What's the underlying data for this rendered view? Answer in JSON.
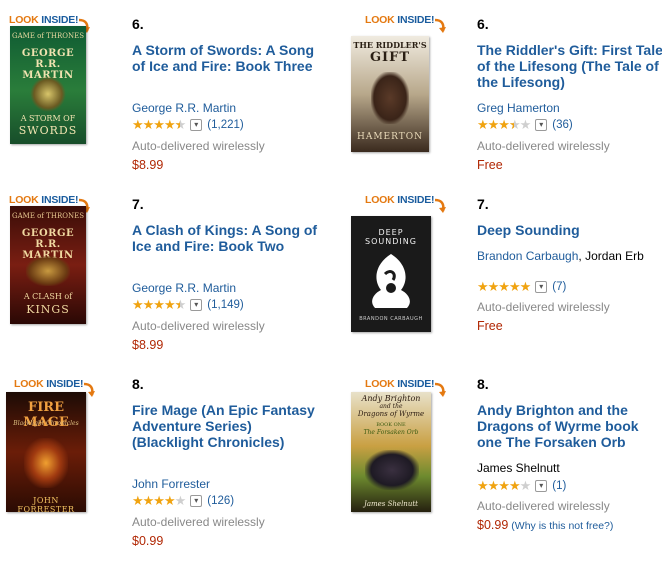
{
  "look_inside": {
    "look": "LOOK",
    "inside": "INSIDE!"
  },
  "items": [
    {
      "rank": "6.",
      "title": "A Storm of Swords: A Song of Ice and Fire: Book Three",
      "authors": [
        "George R.R. Martin"
      ],
      "rating": {
        "stars": 4.5,
        "count": "(1,221)"
      },
      "delivery": "Auto-delivered wirelessly",
      "price": "$8.99",
      "cover": {
        "series": "GAME of THRONES",
        "author": "GEORGE R.R. MARTIN",
        "title_line1": "A STORM OF",
        "title_line2": "SWORDS"
      }
    },
    {
      "rank": "6.",
      "title": "The Riddler's Gift: First Tale of the Lifesong (The Tale of the Lifesong)",
      "authors": [
        "Greg Hamerton"
      ],
      "rating": {
        "stars": 3.5,
        "count": "(36)"
      },
      "delivery": "Auto-delivered wirelessly",
      "price": "Free",
      "cover": {
        "title_line1": "THE RIDDLER'S",
        "title_line2": "GIFT",
        "author": "HAMERTON"
      }
    },
    {
      "rank": "7.",
      "title": "A Clash of Kings: A Song of Ice and Fire: Book Two",
      "authors": [
        "George R.R. Martin"
      ],
      "rating": {
        "stars": 4.5,
        "count": "(1,149)"
      },
      "delivery": "Auto-delivered wirelessly",
      "price": "$8.99",
      "cover": {
        "series": "GAME of THRONES",
        "author": "GEORGE R.R. MARTIN",
        "title_line1": "A CLASH of",
        "title_line2": "KINGS"
      }
    },
    {
      "rank": "7.",
      "title": "Deep Sounding",
      "authors": [
        "Brandon Carbaugh",
        "Jordan Erb"
      ],
      "rating": {
        "stars": 5,
        "count": "(7)"
      },
      "delivery": "Auto-delivered wirelessly",
      "price": "Free",
      "cover": {
        "title": "DEEP SOUNDING",
        "author": "BRANDON CARBAUGH"
      }
    },
    {
      "rank": "8.",
      "title": "Fire Mage (An Epic Fantasy Adventure Series) (Blacklight Chronicles)",
      "authors": [
        "John Forrester"
      ],
      "rating": {
        "stars": 4,
        "count": "(126)"
      },
      "delivery": "Auto-delivered wirelessly",
      "price": "$0.99",
      "cover": {
        "title": "FIRE MAGE",
        "subtitle": "Blacklight Chronicles",
        "author": "JOHN FORRESTER"
      }
    },
    {
      "rank": "8.",
      "title": "Andy Brighton and the Dragons of Wyrme book one The Forsaken Orb",
      "authors": [
        "James Shelnutt"
      ],
      "rating": {
        "stars": 4,
        "count": "(1)"
      },
      "delivery": "Auto-delivered wirelessly",
      "price": "$0.99",
      "price_note": "(Why is this not free?)",
      "cover": {
        "title_line1": "Andy Brighton",
        "title_line2": "and the",
        "title_line3": "Dragons of Wyrme",
        "sub": "BOOK ONE",
        "sub2": "The Forsaken Orb",
        "author": "James Shelnutt"
      }
    }
  ],
  "colors": {
    "link": "#1f5c9b",
    "price": "#b12704",
    "star": "#f0a310",
    "look": "#e47911"
  }
}
